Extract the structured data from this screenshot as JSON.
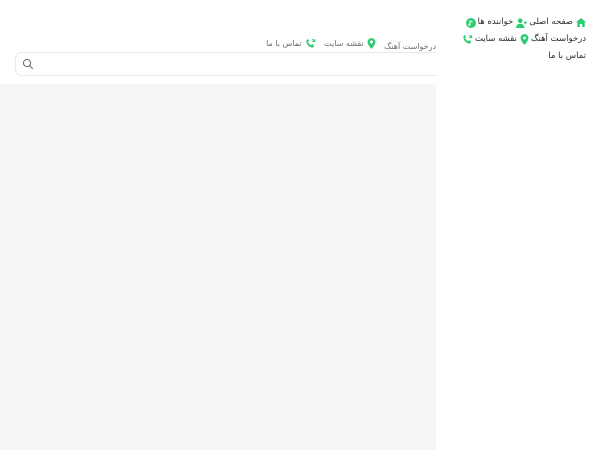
{
  "side_menu": {
    "items": [
      {
        "label": "صفحه اصلی",
        "icon": "home-icon"
      },
      {
        "label": "خواننده ها",
        "icon": "user-add-icon"
      },
      {
        "label": "درخواست آهنگ",
        "icon": "music-circle-icon"
      },
      {
        "label": "نقشه سایت",
        "icon": "map-pin-icon"
      },
      {
        "label": "تماس با ما",
        "icon": "phone-icon"
      }
    ]
  },
  "top_nav": {
    "items": [
      {
        "label": "درخواست آهنگ",
        "icon": "music-circle-icon"
      },
      {
        "label": "نقشه سایت",
        "icon": "map-pin-icon"
      },
      {
        "label": "تماس با ما",
        "icon": "phone-icon"
      }
    ]
  },
  "search": {
    "placeholder": "",
    "value": ""
  },
  "colors": {
    "accent": "#2ecc71",
    "main_bg": "#f4f6f8"
  }
}
